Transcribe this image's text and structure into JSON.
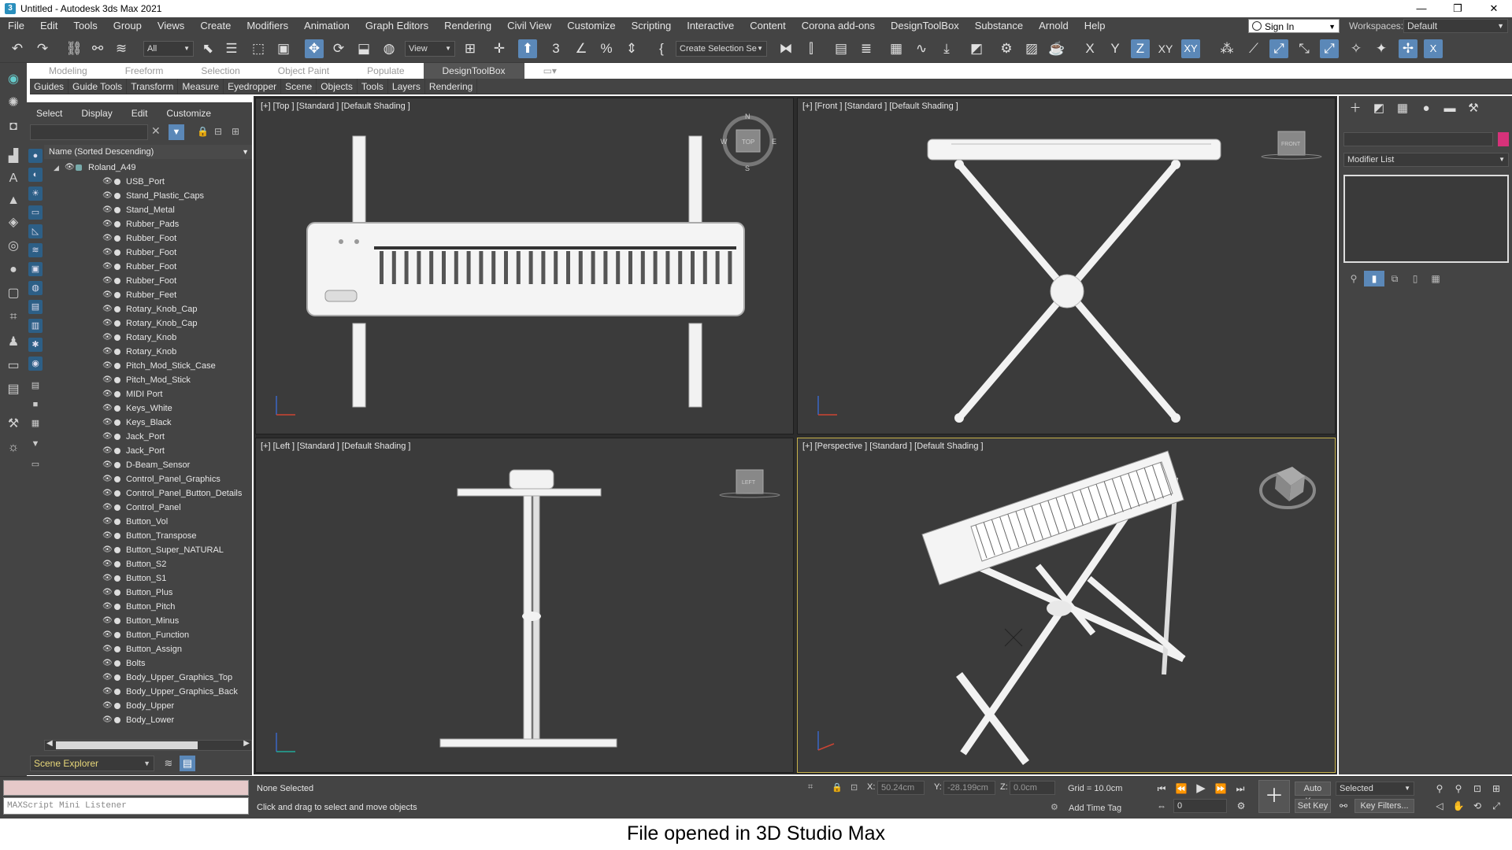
{
  "titlebar": {
    "title": "Untitled - Autodesk 3ds Max 2021",
    "min": "—",
    "max": "❐",
    "close": "✕"
  },
  "menu": [
    "File",
    "Edit",
    "Tools",
    "Group",
    "Views",
    "Create",
    "Modifiers",
    "Animation",
    "Graph Editors",
    "Rendering",
    "Civil View",
    "Customize",
    "Scripting",
    "Interactive",
    "Content",
    "Corona add-ons",
    "DesignToolBox",
    "Substance",
    "Arnold",
    "Help"
  ],
  "signin": "Sign In",
  "workspaces": {
    "label": "Workspaces:",
    "value": "Default"
  },
  "toolbar": {
    "filter": "All",
    "ref_coord": "View",
    "selection_set": "Create Selection Se"
  },
  "ribbon_tabs": [
    "Modeling",
    "Freeform",
    "Selection",
    "Object Paint",
    "Populate",
    "DesignToolBox"
  ],
  "ribbon_sub": [
    "Guides",
    "Guide Tools",
    "Transform",
    "Measure",
    "Eyedropper",
    "Scene",
    "Objects",
    "Tools",
    "Layers",
    "Rendering"
  ],
  "scene_explorer": {
    "menu": [
      "Select",
      "Display",
      "Edit",
      "Customize"
    ],
    "column_header": "Name (Sorted Descending)",
    "root": "Roland_A49",
    "items": [
      "USB_Port",
      "Stand_Plastic_Caps",
      "Stand_Metal",
      "Rubber_Pads",
      "Rubber_Foot",
      "Rubber_Foot",
      "Rubber_Foot",
      "Rubber_Foot",
      "Rubber_Feet",
      "Rotary_Knob_Cap",
      "Rotary_Knob_Cap",
      "Rotary_Knob",
      "Rotary_Knob",
      "Pitch_Mod_Stick_Case",
      "Pitch_Mod_Stick",
      "MIDI Port",
      "Keys_White",
      "Keys_Black",
      "Jack_Port",
      "Jack_Port",
      "D-Beam_Sensor",
      "Control_Panel_Graphics",
      "Control_Panel_Button_Details",
      "Control_Panel",
      "Button_Vol",
      "Button_Transpose",
      "Button_Super_NATURAL",
      "Button_S2",
      "Button_S1",
      "Button_Plus",
      "Button_Pitch",
      "Button_Minus",
      "Button_Function",
      "Button_Assign",
      "Bolts",
      "Body_Upper_Graphics_Top",
      "Body_Upper_Graphics_Back",
      "Body_Upper",
      "Body_Lower"
    ],
    "footer": "Scene Explorer"
  },
  "viewports": {
    "top": "[+] [Top ] [Standard ] [Default Shading ]",
    "front": "[+] [Front ] [Standard ] [Default Shading ]",
    "left": "[+] [Left ] [Standard ] [Default Shading ]",
    "perspective": "[+] [Perspective ] [Standard ] [Default Shading ]",
    "viewcube_top": "TOP",
    "viewcube_front": "FRONT",
    "viewcube_left": "LEFT",
    "compass": {
      "n": "N",
      "s": "S",
      "e": "E",
      "w": "W"
    }
  },
  "command_panel": {
    "modifier_list": "Modifier List"
  },
  "status": {
    "listener": "MAXScript Mini Listener",
    "selection": "None Selected",
    "prompt": "Click and drag to select and move objects",
    "x_label": "X:",
    "x_value": "50.24cm",
    "y_label": "Y:",
    "y_value": "-28.199cm",
    "z_label": "Z:",
    "z_value": "0.0cm",
    "grid": "Grid = 10.0cm",
    "add_time_tag": "Add Time Tag",
    "auto_key": "Auto Key",
    "set_key": "Set Key",
    "selected": "Selected",
    "key_filters": "Key Filters...",
    "frame": "0"
  },
  "caption": "File opened in 3D Studio Max"
}
